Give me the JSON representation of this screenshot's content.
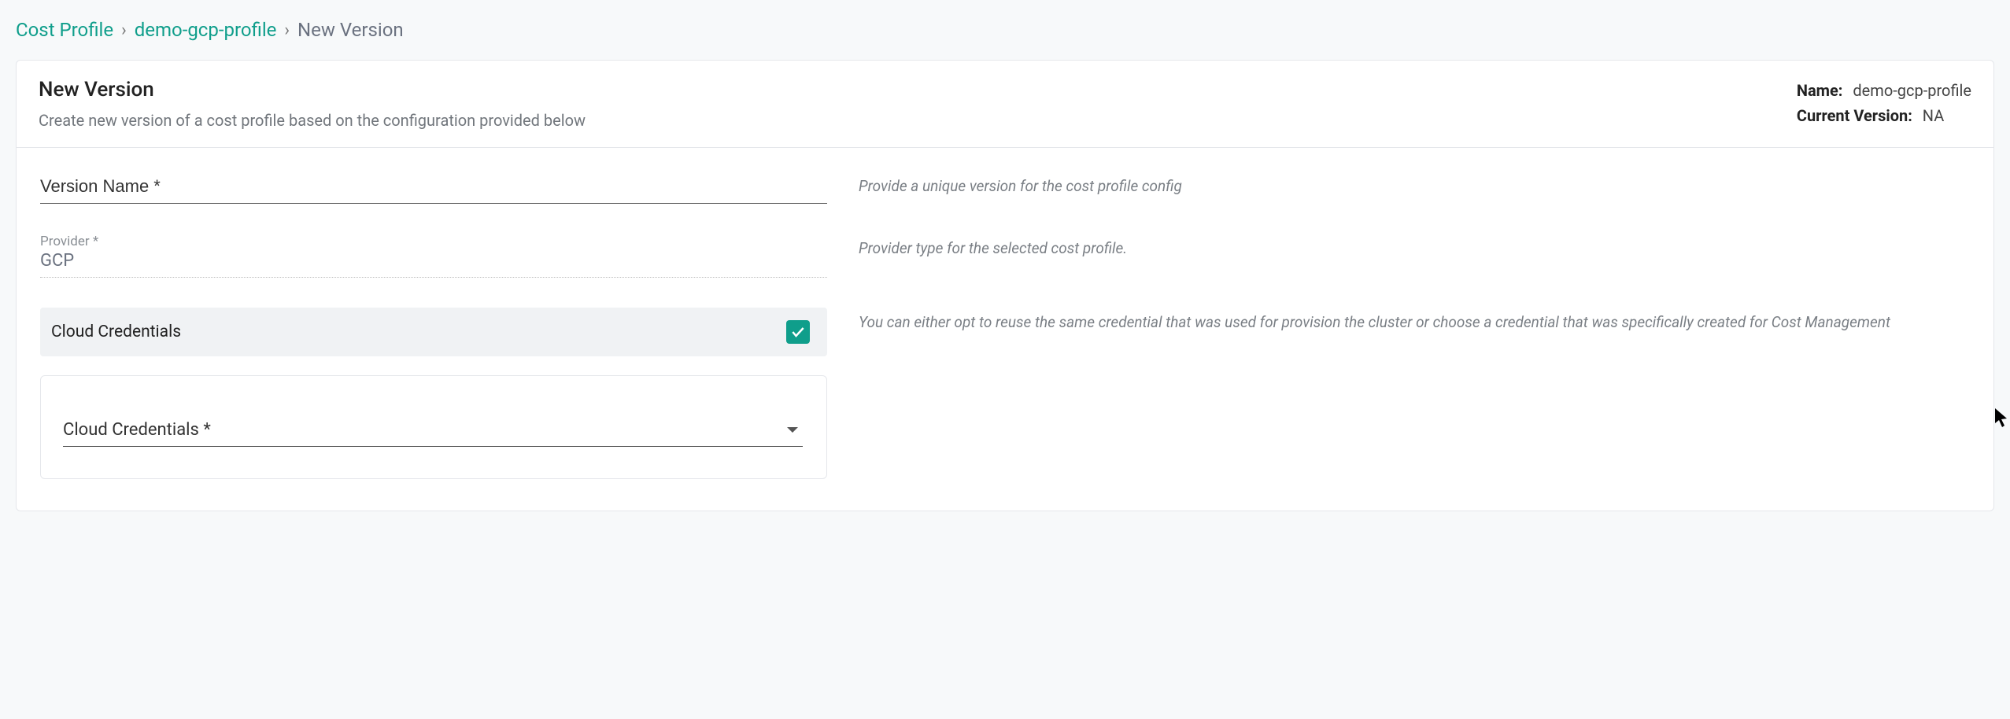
{
  "breadcrumb": {
    "root": "Cost Profile",
    "profile": "demo-gcp-profile",
    "current": "New Version"
  },
  "header": {
    "title": "New Version",
    "subtitle": "Create new version of a cost profile based on the configuration provided below",
    "name_label": "Name:",
    "name_value": "demo-gcp-profile",
    "version_label": "Current Version:",
    "version_value": "NA"
  },
  "form": {
    "version_name": {
      "placeholder": "Version Name *",
      "value": "",
      "help": "Provide a unique version for the cost profile config"
    },
    "provider": {
      "label": "Provider *",
      "value": "GCP",
      "help": "Provider type for the selected cost profile."
    },
    "credentials_section": {
      "title": "Cloud Credentials",
      "checked": true,
      "help": "You can either opt to reuse the same credential that was used for provision the cluster or choose a credential that was specifically created for Cost Management",
      "select_placeholder": "Cloud Credentials *"
    }
  }
}
